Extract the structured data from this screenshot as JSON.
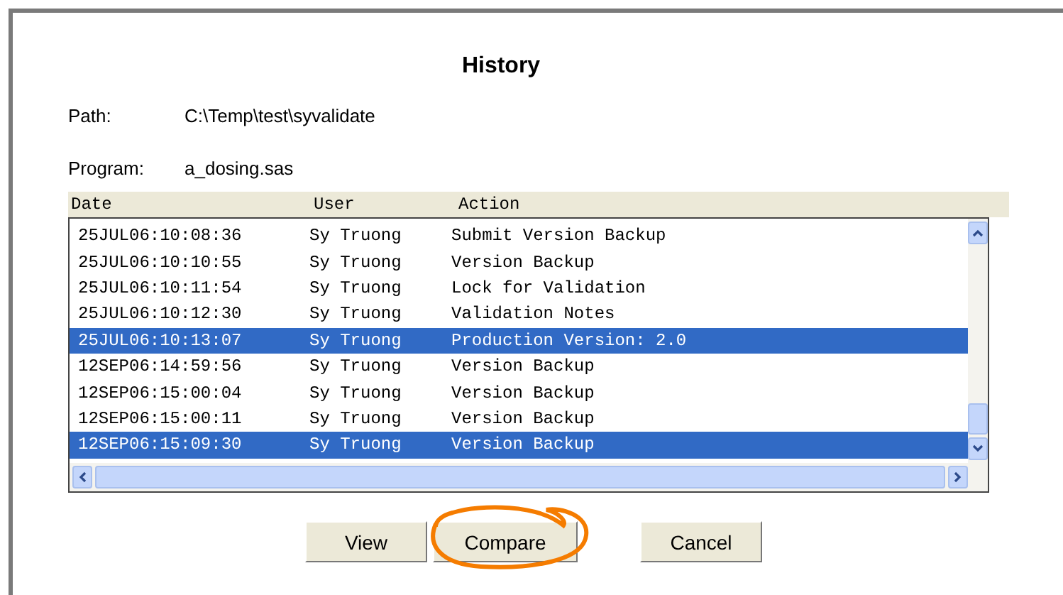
{
  "title": "History",
  "fields": [
    {
      "label": "Path:",
      "value": "C:\\Temp\\test\\syvalidate"
    },
    {
      "label": "Program:",
      "value": "a_dosing.sas"
    }
  ],
  "table": {
    "columns": [
      "Date",
      "User",
      "Action"
    ],
    "rows": [
      {
        "cells": [
          "25JUL06:10:08:36",
          "Sy Truong",
          "Submit Version Backup"
        ],
        "selected": false
      },
      {
        "cells": [
          "25JUL06:10:10:55",
          "Sy Truong",
          "Version Backup"
        ],
        "selected": false
      },
      {
        "cells": [
          "25JUL06:10:11:54",
          "Sy Truong",
          "Lock for Validation"
        ],
        "selected": false
      },
      {
        "cells": [
          "25JUL06:10:12:30",
          "Sy Truong",
          "Validation Notes"
        ],
        "selected": false
      },
      {
        "cells": [
          "25JUL06:10:13:07",
          "Sy Truong",
          "Production Version: 2.0"
        ],
        "selected": true
      },
      {
        "cells": [
          "12SEP06:14:59:56",
          "Sy Truong",
          "Version Backup"
        ],
        "selected": false
      },
      {
        "cells": [
          "12SEP06:15:00:04",
          "Sy Truong",
          "Version Backup"
        ],
        "selected": false
      },
      {
        "cells": [
          "12SEP06:15:00:11",
          "Sy Truong",
          "Version Backup"
        ],
        "selected": false
      },
      {
        "cells": [
          "12SEP06:15:09:30",
          "Sy Truong",
          "Version Backup"
        ],
        "selected": true
      }
    ]
  },
  "buttons": [
    {
      "label": "View",
      "circled": false
    },
    {
      "label": "Compare",
      "circled": true
    },
    {
      "label": "Cancel",
      "circled": false
    }
  ]
}
